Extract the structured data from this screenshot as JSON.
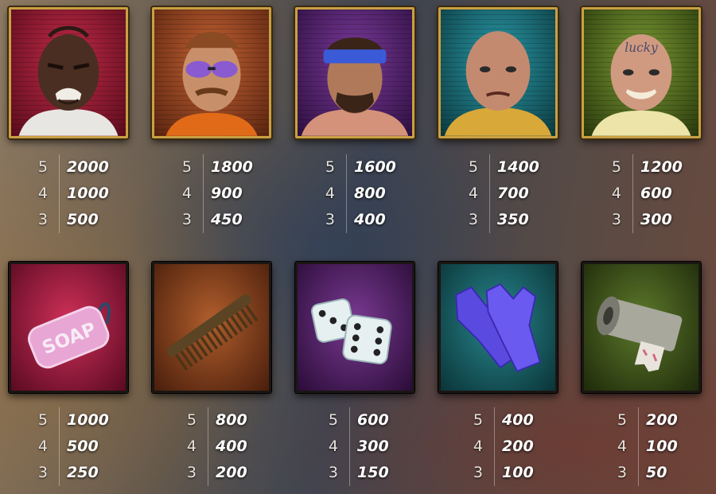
{
  "characters": [
    {
      "id": "tattoo-face-prisoner",
      "bg": "#a01830",
      "tattoo": "",
      "pays": [
        {
          "count": "5",
          "value": "2000"
        },
        {
          "count": "4",
          "value": "1000"
        },
        {
          "count": "3",
          "value": "500"
        }
      ]
    },
    {
      "id": "sunglasses-prisoner",
      "bg": "#a0502a",
      "tattoo": "",
      "pays": [
        {
          "count": "5",
          "value": "1800"
        },
        {
          "count": "4",
          "value": "900"
        },
        {
          "count": "3",
          "value": "450"
        }
      ]
    },
    {
      "id": "bandana-prisoner",
      "bg": "#5b2a7a",
      "tattoo": "",
      "pays": [
        {
          "count": "5",
          "value": "1600"
        },
        {
          "count": "4",
          "value": "800"
        },
        {
          "count": "3",
          "value": "400"
        }
      ]
    },
    {
      "id": "bald-prisoner",
      "bg": "#1f6f7a",
      "tattoo": "",
      "pays": [
        {
          "count": "5",
          "value": "1400"
        },
        {
          "count": "4",
          "value": "700"
        },
        {
          "count": "3",
          "value": "350"
        }
      ]
    },
    {
      "id": "lucky-tattoo-prisoner",
      "bg": "#5e7a2a",
      "tattoo": "lucky",
      "pays": [
        {
          "count": "5",
          "value": "1200"
        },
        {
          "count": "4",
          "value": "600"
        },
        {
          "count": "3",
          "value": "300"
        }
      ]
    }
  ],
  "items": [
    {
      "id": "soap",
      "bg": "#b8244a",
      "label": "SOAP",
      "pays": [
        {
          "count": "5",
          "value": "1000"
        },
        {
          "count": "4",
          "value": "500"
        },
        {
          "count": "3",
          "value": "250"
        }
      ]
    },
    {
      "id": "comb",
      "bg": "#8a4a24",
      "label": "",
      "pays": [
        {
          "count": "5",
          "value": "800"
        },
        {
          "count": "4",
          "value": "400"
        },
        {
          "count": "3",
          "value": "200"
        }
      ]
    },
    {
      "id": "dice",
      "bg": "#5a2a6e",
      "label": "",
      "pays": [
        {
          "count": "5",
          "value": "600"
        },
        {
          "count": "4",
          "value": "300"
        },
        {
          "count": "3",
          "value": "150"
        }
      ]
    },
    {
      "id": "gloves",
      "bg": "#1e6a70",
      "label": "",
      "pays": [
        {
          "count": "5",
          "value": "400"
        },
        {
          "count": "4",
          "value": "200"
        },
        {
          "count": "3",
          "value": "100"
        }
      ]
    },
    {
      "id": "toilet-paper",
      "bg": "#4a5e22",
      "label": "",
      "pays": [
        {
          "count": "5",
          "value": "200"
        },
        {
          "count": "4",
          "value": "100"
        },
        {
          "count": "3",
          "value": "50"
        }
      ]
    }
  ]
}
